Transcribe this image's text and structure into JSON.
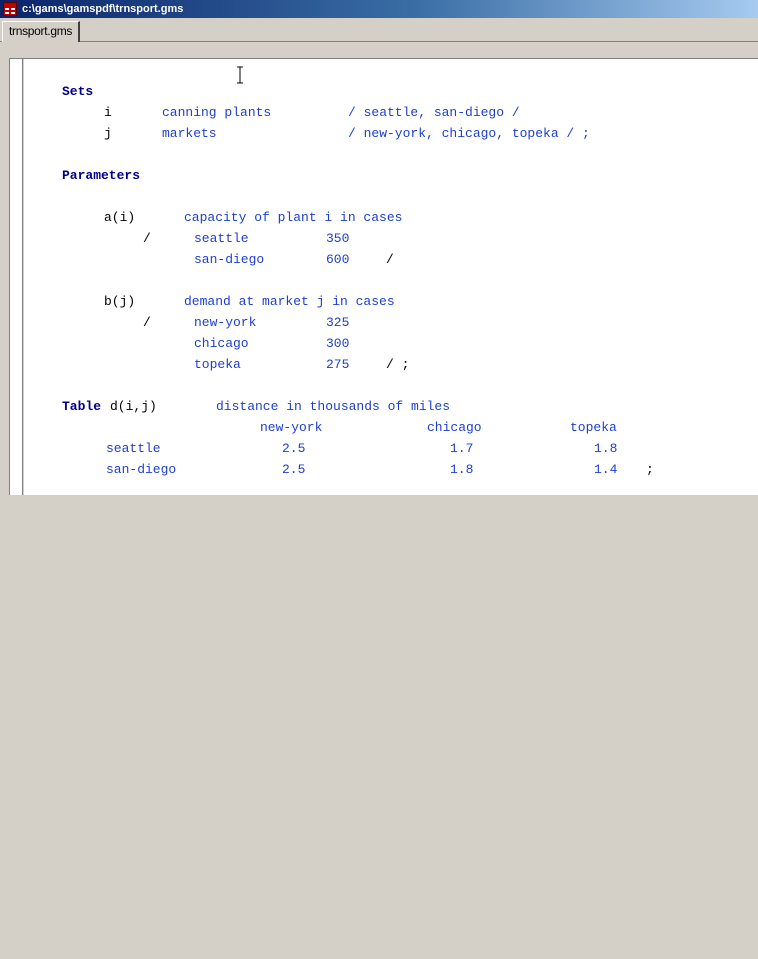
{
  "window": {
    "title": "c:\\gams\\gamspdf\\trnsport.gms"
  },
  "tabs": [
    {
      "label": "trnsport.gms"
    }
  ],
  "code": {
    "sets_keyword": "Sets",
    "set_i_name": "i",
    "set_i_desc": "canning plants",
    "set_i_elems": "/ seattle, san-diego /",
    "set_j_name": "j",
    "set_j_desc": "markets",
    "set_j_elems": "/ new-york, chicago, topeka / ;",
    "params_keyword": "Parameters",
    "a_name": "a(i)",
    "a_desc": "capacity of plant i in cases",
    "a_row1_open": "/",
    "a_row1_label": "seattle",
    "a_row1_value": "350",
    "a_row2_label": "san-diego",
    "a_row2_value": "600",
    "a_row2_close": "/",
    "b_name": "b(j)",
    "b_desc": "demand at market j in cases",
    "b_row1_open": "/",
    "b_row1_label": "new-york",
    "b_row1_value": "325",
    "b_row2_label": "chicago",
    "b_row2_value": "300",
    "b_row3_label": "topeka",
    "b_row3_value": "275",
    "b_row3_close": "/ ;",
    "table_keyword": "Table",
    "table_name": "d(i,j)",
    "table_desc": "distance in thousands of miles",
    "table_columns": [
      "new-york",
      "chicago",
      "topeka"
    ],
    "table_rows": [
      {
        "label": "seattle",
        "values": [
          "2.5",
          "1.7",
          "1.8"
        ],
        "end": ""
      },
      {
        "label": "san-diego",
        "values": [
          "2.5",
          "1.8",
          "1.4"
        ],
        "end": ";"
      }
    ]
  },
  "colors": {
    "keyword": "#00008b",
    "comment": "#1e3fcf",
    "titlebar": "#0a246a"
  }
}
